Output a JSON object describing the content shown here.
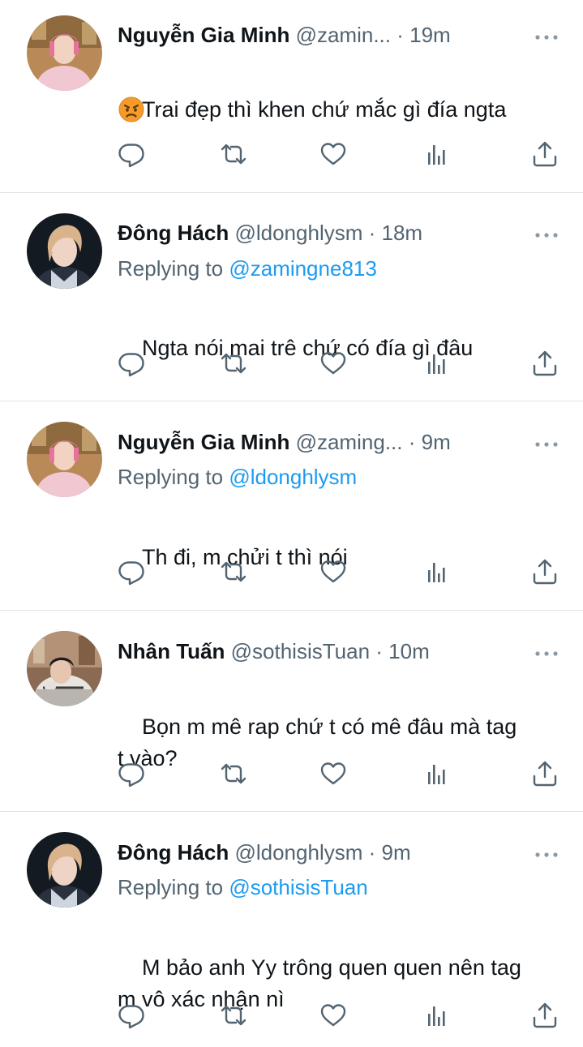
{
  "tweets": [
    {
      "name": "Nguyễn Gia Minh",
      "handle": "@zamin...",
      "dot": "·",
      "time": "19m",
      "replying_prefix": "",
      "replying_to": "",
      "text": "Trai đẹp thì khen chứ mắc gì đía ngta",
      "emoji": "😠",
      "avatar": "pink-hair-person"
    },
    {
      "name": "Đông Hách",
      "handle": "@ldonghlysm",
      "dot": "·",
      "time": "18m",
      "replying_prefix": "Replying to",
      "replying_to": "@zamingne813",
      "text": "Ngta nói mai trê chứ có đía gì đâu",
      "avatar": "blond-hair-person"
    },
    {
      "name": "Nguyễn Gia Minh",
      "handle": "@zaming...",
      "dot": "·",
      "time": "9m",
      "replying_prefix": "Replying to",
      "replying_to": "@ldonghlysm",
      "text": "Th đi, m chửi t thì nói",
      "avatar": "pink-hair-person"
    },
    {
      "name": "Nhân Tuấn",
      "handle": "@sothisisTuan",
      "dot": "·",
      "time": "10m",
      "replying_prefix": "",
      "replying_to": "",
      "text": "Bọn m mê rap chứ t có mê đâu mà tag\nt vào?",
      "avatar": "person-in-plaid-coat"
    },
    {
      "name": "Đông Hách",
      "handle": "@ldonghlysm",
      "dot": "·",
      "time": "9m",
      "replying_prefix": "Replying to",
      "replying_to": "@sothisisTuan",
      "text": "M bảo anh Yy trông quen quen nên tag\nm vô xác nhận nì",
      "avatar": "blond-hair-person"
    }
  ],
  "icons": {
    "reply": "reply-icon",
    "retweet": "retweet-icon",
    "like": "heart-icon",
    "views": "views-icon",
    "share": "share-icon",
    "more": "more-icon"
  },
  "colors": {
    "text": "#0f1419",
    "secondary": "#536471",
    "link": "#1d9bf0",
    "divider": "#dfe3e6"
  }
}
